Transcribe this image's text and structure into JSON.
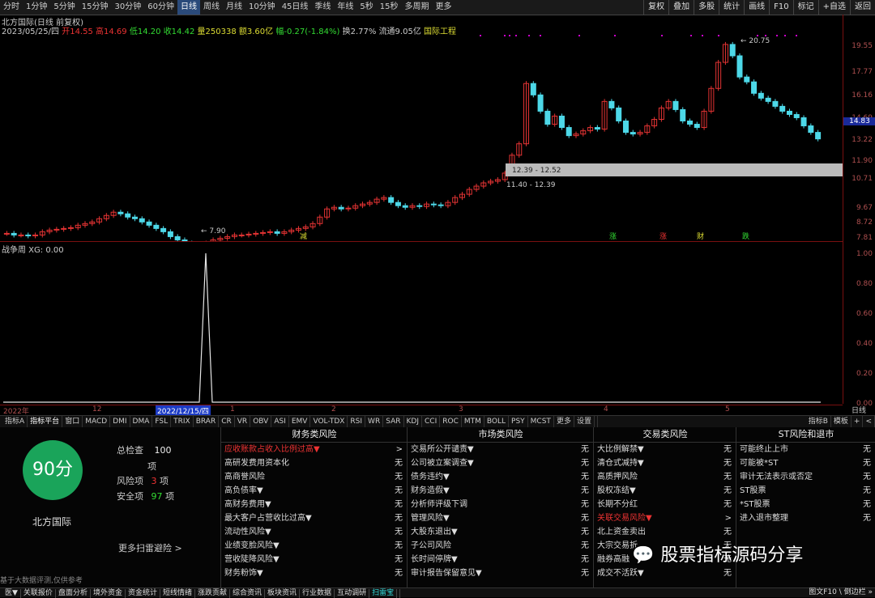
{
  "periods": [
    "分时",
    "1分钟",
    "5分钟",
    "15分钟",
    "30分钟",
    "60分钟",
    "日线",
    "周线",
    "月线",
    "10分钟",
    "45日线",
    "季线",
    "年线",
    "5秒",
    "15秒",
    "多周期",
    "更多"
  ],
  "active_period": "日线",
  "right_tools": [
    "复权",
    "叠加",
    "多股",
    "统计",
    "画线",
    "F10",
    "标记",
    "+自选",
    "返回"
  ],
  "stock_title": "北方国际(日线 前复权)",
  "quote_line": {
    "date": "2023/05/25/四",
    "open": "开14.55",
    "high": "高14.69",
    "low": "低14.20",
    "close": "收14.42",
    "vol": "量250338",
    "amt": "额3.60亿",
    "chg": "幅-0.27(-1.84%)",
    "turn": "换2.77%",
    "float": "流通9.05亿",
    "sector": "国际工程"
  },
  "price_ticks": [
    "19.55",
    "17.77",
    "16.16",
    "14.69",
    "13.22",
    "11.90",
    "10.71",
    "9.67",
    "8.72",
    "7.81"
  ],
  "current_price": "14.83",
  "gap_label1": "12.39 - 12.52",
  "gap_label2": "11.40 - 12.39",
  "high_marker": "20.75",
  "low_marker": "7.90",
  "event_tags": [
    "减",
    "涨",
    "涨",
    "财",
    "跌"
  ],
  "indicator_name": "战争周 XG: 0.00",
  "ind_ticks": [
    "1.00",
    "0.80",
    "0.60",
    "0.40",
    "0.20",
    "0.00"
  ],
  "date_labels": [
    "2022年",
    "12",
    "2022/12/15/四",
    "1",
    "2",
    "3",
    "4",
    "5"
  ],
  "date_right": "日线",
  "ind_tabs": [
    "指标A",
    "指标平台",
    "窗口",
    "MACD",
    "DMI",
    "DMA",
    "FSL",
    "TRIX",
    "BRAR",
    "CR",
    "VR",
    "OBV",
    "ASI",
    "EMV",
    "VOL-TDX",
    "RSI",
    "WR",
    "SAR",
    "KDJ",
    "CCI",
    "ROC",
    "MTM",
    "BOLL",
    "PSY",
    "MCST",
    "更多",
    "设置"
  ],
  "ind_tabs_right": [
    "指标B",
    "模板",
    "+",
    "<"
  ],
  "score": "90分",
  "company": "北方国际",
  "stats": {
    "total_label": "总检查",
    "total": "100",
    "total_unit": "项",
    "risk_label": "风险项",
    "risk": "3",
    "risk_unit": "项",
    "safe_label": "安全项",
    "safe": "97",
    "safe_unit": "项"
  },
  "more_scan": "更多扫雷避险 >",
  "disclaimer": "基于大数据评测,仅供参考",
  "columns": [
    {
      "title": "财务类风险",
      "rows": [
        [
          "应收账款占收入比例过高▼",
          ">",
          true
        ],
        [
          "高研发费用资本化",
          "无",
          false
        ],
        [
          "高商誉风险",
          "无",
          false
        ],
        [
          "高负债率▼",
          "无",
          false
        ],
        [
          "高财务费用▼",
          "无",
          false
        ],
        [
          "最大客户占营收比过高▼",
          "无",
          false
        ],
        [
          "流动性风险▼",
          "无",
          false
        ],
        [
          "业绩变脸风险▼",
          "无",
          false
        ],
        [
          "营收陡降风险▼",
          "无",
          false
        ],
        [
          "财务粉饰▼",
          "无",
          false
        ]
      ]
    },
    {
      "title": "市场类风险",
      "rows": [
        [
          "交易所公开谴责▼",
          "无",
          false
        ],
        [
          "公司被立案调查▼",
          "无",
          false
        ],
        [
          "债务违约▼",
          "无",
          false
        ],
        [
          "财务造假▼",
          "无",
          false
        ],
        [
          "分析师评级下调",
          "无",
          false
        ],
        [
          "管理风险▼",
          "无",
          false
        ],
        [
          "大股东退出▼",
          "无",
          false
        ],
        [
          "子公司风险",
          "无",
          false
        ],
        [
          "长时间停牌▼",
          "无",
          false
        ],
        [
          "审计报告保留意见▼",
          "无",
          false
        ]
      ]
    },
    {
      "title": "交易类风险",
      "rows": [
        [
          "大比例解禁▼",
          "无",
          false
        ],
        [
          "清仓式减持▼",
          "无",
          false
        ],
        [
          "高质押风险",
          "无",
          false
        ],
        [
          "股权冻结▼",
          "无",
          false
        ],
        [
          "长期不分红",
          "无",
          false
        ],
        [
          "关联交易风险▼",
          ">",
          true
        ],
        [
          "北上资金卖出",
          "无",
          false
        ],
        [
          "大宗交易折",
          "无",
          false
        ],
        [
          "融券高融",
          "无",
          false
        ],
        [
          "成交不活跃▼",
          "无",
          false
        ]
      ]
    },
    {
      "title": "ST风险和退市",
      "rows": [
        [
          "可能终止上市",
          "无",
          false
        ],
        [
          "可能被*ST",
          "无",
          false
        ],
        [
          "审计无法表示或否定",
          "无",
          false
        ],
        [
          "ST股票",
          "无",
          false
        ],
        [
          "*ST股票",
          "无",
          false
        ],
        [
          "进入退市整理",
          "无",
          false
        ]
      ]
    }
  ],
  "bottom_tabs": [
    "医▼",
    "关联报价",
    "盘面分析",
    "境外资金",
    "资金统计",
    "短线情绪",
    "涨跌贡献",
    "综合资讯",
    "板块资讯",
    "行业数据",
    "互动调研",
    "扫雷宝"
  ],
  "bottom_active": "扫雷宝",
  "bottom_right": "图文F10 \\ 倒边栏 »",
  "watermark": "股票指标源码分享",
  "colors": {
    "up": "#e33333",
    "down": "#4dd8e8",
    "accent": "#1aa45a"
  }
}
